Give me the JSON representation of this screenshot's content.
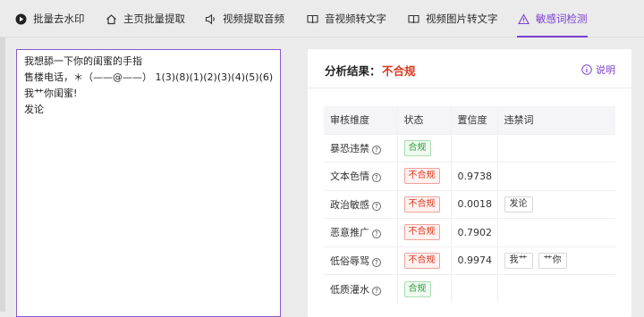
{
  "nav": {
    "tabs": [
      {
        "label": "批量去水印",
        "icon": "play-circle-icon"
      },
      {
        "label": "主页批量提取",
        "icon": "home-icon"
      },
      {
        "label": "视频提取音频",
        "icon": "speaker-icon"
      },
      {
        "label": "音视频转文字",
        "icon": "book-icon"
      },
      {
        "label": "视频图片转文字",
        "icon": "book-icon"
      },
      {
        "label": "敏感词检测",
        "icon": "warning-triangle-icon",
        "active": true
      }
    ],
    "active_color": "#7b3fd0"
  },
  "editor": {
    "lines": [
      "我想舔一下你的闺蜜的手指",
      "售楼电话，＊（——@——）  1(3)(8)(1)(2)(3)(4)(5)(6)",
      "我艹你闺蜜!",
      "发论"
    ]
  },
  "result": {
    "label": "分析结果：",
    "value": "不合规",
    "explain": "说明"
  },
  "table": {
    "headers": [
      "审核维度",
      "状态",
      "置信度",
      "违禁词"
    ],
    "rows": [
      {
        "dimension": "暴恐违禁",
        "status": "合规",
        "ok": true,
        "confidence": "",
        "words": []
      },
      {
        "dimension": "文本色情",
        "status": "不合规",
        "ok": false,
        "confidence": "0.9738",
        "words": []
      },
      {
        "dimension": "政治敏感",
        "status": "不合规",
        "ok": false,
        "confidence": "0.0018",
        "words": [
          "发论"
        ]
      },
      {
        "dimension": "恶意推广",
        "status": "不合规",
        "ok": false,
        "confidence": "0.7902",
        "words": []
      },
      {
        "dimension": "低俗辱骂",
        "status": "不合规",
        "ok": false,
        "confidence": "0.9974",
        "words": [
          "我艹",
          "艹你"
        ]
      },
      {
        "dimension": "低质灌水",
        "status": "合规",
        "ok": true,
        "confidence": "",
        "words": []
      }
    ]
  },
  "colors": {
    "ok": "#2f9e3f",
    "bad": "#d9381e",
    "accent": "#7b3fd0"
  }
}
